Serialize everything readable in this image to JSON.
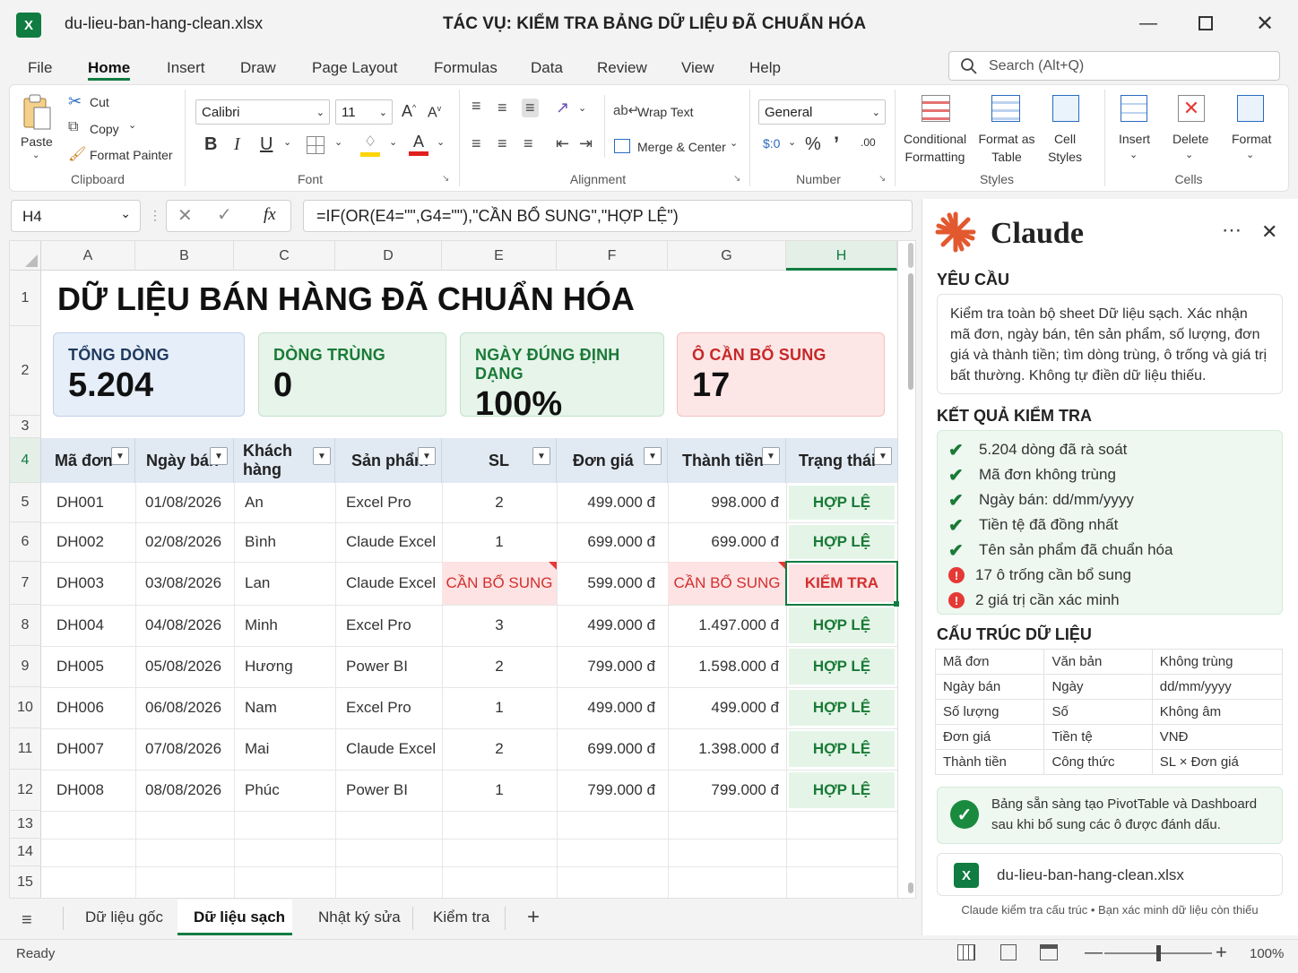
{
  "window": {
    "filename": "du-lieu-ban-hang-clean.xlsx",
    "task_title": "TÁC VỤ: KIỂM TRA BẢNG DỮ LIỆU ĐÃ CHUẨN HÓA"
  },
  "menu": [
    "File",
    "Home",
    "Insert",
    "Draw",
    "Page Layout",
    "Formulas",
    "Data",
    "Review",
    "View",
    "Help"
  ],
  "search_placeholder": "Search (Alt+Q)",
  "ribbon": {
    "paste": "Paste",
    "cut": "Cut",
    "copy": "Copy",
    "format_painter": "Format Painter",
    "clipboard": "Clipboard",
    "font_name": "Calibri",
    "font_size": "11",
    "font": "Font",
    "wrap_text": "Wrap Text",
    "merge_center": "Merge & Center",
    "alignment": "Alignment",
    "number_format": "General",
    "number": "Number",
    "conditional_formatting": "Conditional Formatting",
    "format_as_table": "Format as Table",
    "cell_styles": "Cell Styles",
    "styles": "Styles",
    "insert": "Insert",
    "delete": "Delete",
    "format": "Format",
    "cells": "Cells"
  },
  "formula_bar": {
    "name_box": "H4",
    "fx": "fx",
    "formula": "=IF(OR(E4=\"\",G4=\"\"),\"CẦN BỔ SUNG\",\"HỢP LỆ\")"
  },
  "sheet": {
    "columns": [
      "A",
      "B",
      "C",
      "D",
      "E",
      "F",
      "G",
      "H"
    ],
    "rows": [
      "1",
      "2",
      "3",
      "4",
      "5",
      "6",
      "7",
      "8",
      "9",
      "10",
      "11",
      "12",
      "13",
      "14",
      "15"
    ],
    "title": "DỮ LIỆU BÁN HÀNG ĐÃ CHUẨN HÓA",
    "kpis": [
      {
        "label": "TỔNG DÒNG",
        "value": "5.204"
      },
      {
        "label": "DÒNG TRÙNG",
        "value": "0"
      },
      {
        "label": "NGÀY ĐÚNG ĐỊNH DẠNG",
        "value": "100%"
      },
      {
        "label": "Ô CẦN BỔ SUNG",
        "value": "17"
      }
    ],
    "headers": [
      "Mã đơn",
      "Ngày bán",
      "Khách hàng",
      "Sản phẩm",
      "SL",
      "Đơn giá",
      "Thành tiền",
      "Trạng thái"
    ],
    "data": [
      [
        "DH001",
        "01/08/2026",
        "An",
        "Excel Pro",
        "2",
        "499.000 đ",
        "998.000 đ",
        "HỢP LỆ"
      ],
      [
        "DH002",
        "02/08/2026",
        "Bình",
        "Claude Excel",
        "1",
        "699.000 đ",
        "699.000 đ",
        "HỢP LỆ"
      ],
      [
        "DH003",
        "03/08/2026",
        "Lan",
        "Claude Excel",
        "CẦN BỔ SUNG",
        "599.000 đ",
        "CẦN BỔ SUNG",
        "KIỂM TRA"
      ],
      [
        "DH004",
        "04/08/2026",
        "Minh",
        "Excel Pro",
        "3",
        "499.000 đ",
        "1.497.000 đ",
        "HỢP LỆ"
      ],
      [
        "DH005",
        "05/08/2026",
        "Hương",
        "Power BI",
        "2",
        "799.000 đ",
        "1.598.000 đ",
        "HỢP LỆ"
      ],
      [
        "DH006",
        "06/08/2026",
        "Nam",
        "Excel Pro",
        "1",
        "499.000 đ",
        "499.000 đ",
        "HỢP LỆ"
      ],
      [
        "DH007",
        "07/08/2026",
        "Mai",
        "Claude Excel",
        "2",
        "699.000 đ",
        "1.398.000 đ",
        "HỢP LỆ"
      ],
      [
        "DH008",
        "08/08/2026",
        "Phúc",
        "Power BI",
        "1",
        "799.000 đ",
        "799.000 đ",
        "HỢP LỆ"
      ]
    ]
  },
  "tabs": [
    "Dữ liệu gốc",
    "Dữ liệu sạch",
    "Nhật ký sửa",
    "Kiểm tra"
  ],
  "status": {
    "ready": "Ready",
    "zoom": "100%"
  },
  "panel": {
    "title": "Claude",
    "request_heading": "YÊU CẦU",
    "request_text": "Kiểm tra toàn bộ sheet Dữ liệu sạch. Xác nhận mã đơn, ngày bán, tên sản phẩm, số lượng, đơn giá và thành tiền; tìm dòng trùng, ô trống và giá trị bất thường. Không tự điền dữ liệu thiếu.",
    "result_heading": "KẾT QUẢ KIỂM TRA",
    "checks": [
      {
        "text": "5.204 dòng đã rà soát",
        "status": "ok"
      },
      {
        "text": "Mã đơn không trùng",
        "status": "ok"
      },
      {
        "text": "Ngày bán: dd/mm/yyyy",
        "status": "ok"
      },
      {
        "text": "Tiền tệ đã đồng nhất",
        "status": "ok"
      },
      {
        "text": "Tên sản phẩm đã chuẩn hóa",
        "status": "ok"
      },
      {
        "text": "17 ô trống cần bổ sung",
        "status": "warn"
      },
      {
        "text": "2 giá trị cần xác minh",
        "status": "warn"
      }
    ],
    "structure_heading": "CẤU TRÚC DỮ LIỆU",
    "structure": [
      [
        "Mã đơn",
        "Văn bản",
        "Không trùng"
      ],
      [
        "Ngày bán",
        "Ngày",
        "dd/mm/yyyy"
      ],
      [
        "Số lượng",
        "Số",
        "Không âm"
      ],
      [
        "Đơn giá",
        "Tiền tệ",
        "VNĐ"
      ],
      [
        "Thành tiền",
        "Công thức",
        "SL × Đơn giá"
      ]
    ],
    "ready_line1": "Bảng sẵn sàng tạo PivotTable và Dashboard",
    "ready_line2": "sau khi bổ sung các ô được đánh dấu.",
    "file_chip": "du-lieu-ban-hang-clean.xlsx",
    "footer": "Claude kiểm tra cấu trúc • Bạn xác minh dữ liệu còn thiếu"
  }
}
